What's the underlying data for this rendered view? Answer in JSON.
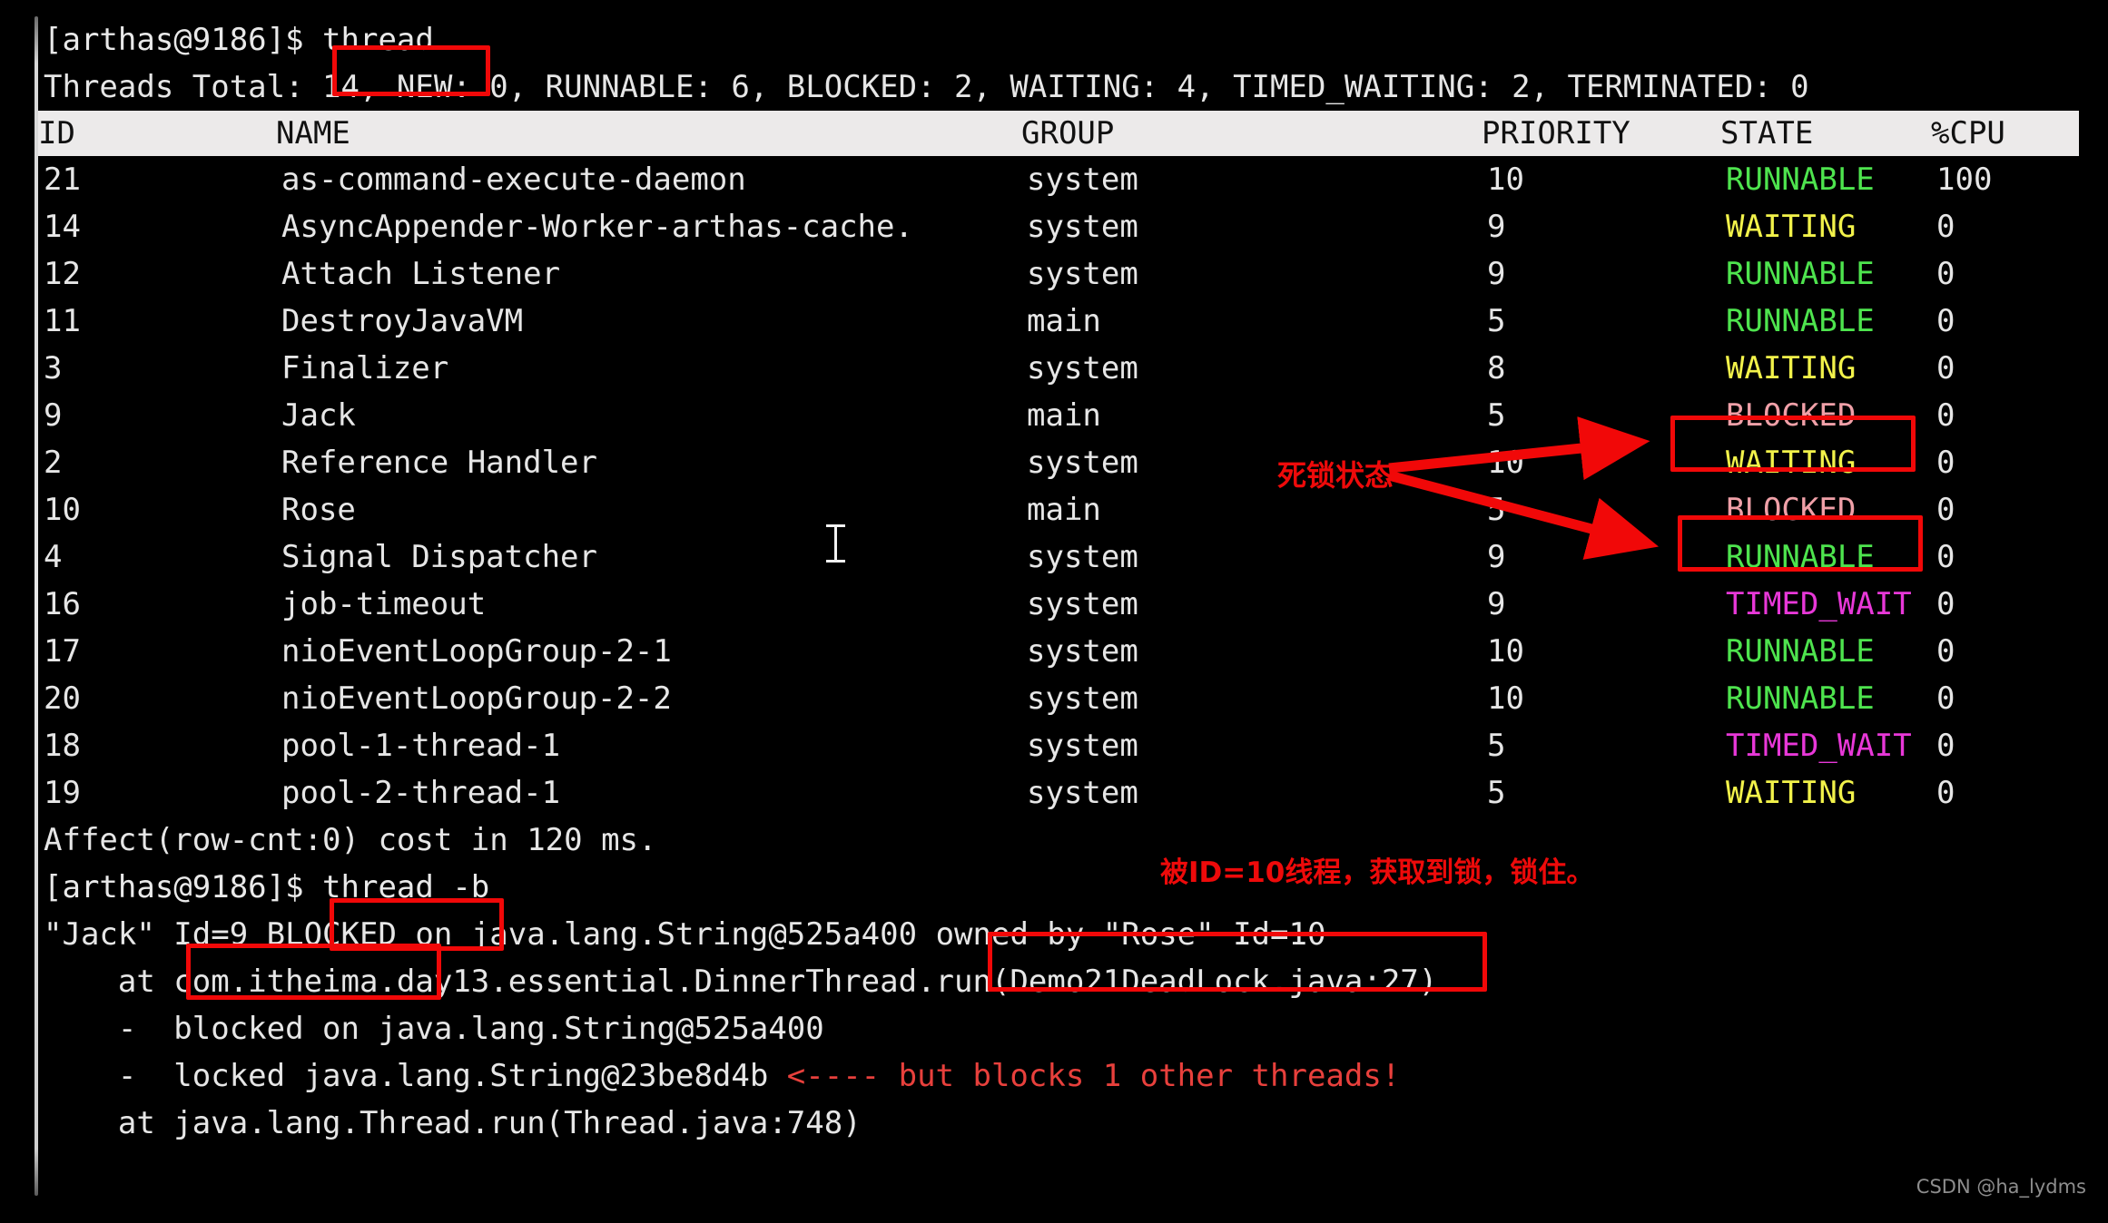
{
  "terminal": {
    "prompt": "[arthas@9186]$ ",
    "command_1": "thread",
    "summary_line": "Threads Total: 14, NEW: 0, RUNNABLE: 6, BLOCKED: 2, WAITING: 4, TIMED_WAITING: 2, TERMINATED: 0",
    "affect_line": "Affect(row-cnt:0) cost in 120 ms.",
    "command_2": "thread -b"
  },
  "table": {
    "headers": {
      "id": "ID",
      "name": "NAME",
      "group": "GROUP",
      "priority": "PRIORITY",
      "state": "STATE",
      "cpu": "%CPU"
    },
    "rows": [
      {
        "id": "21",
        "name": "as-command-execute-daemon",
        "group": "system",
        "priority": "10",
        "state": "RUNNABLE",
        "state_color": "green",
        "cpu": "100"
      },
      {
        "id": "14",
        "name": "AsyncAppender-Worker-arthas-cache.",
        "group": "system",
        "priority": "9",
        "state": "WAITING",
        "state_color": "yellow",
        "cpu": "0"
      },
      {
        "id": "12",
        "name": "Attach Listener",
        "group": "system",
        "priority": "9",
        "state": "RUNNABLE",
        "state_color": "green",
        "cpu": "0"
      },
      {
        "id": "11",
        "name": "DestroyJavaVM",
        "group": "main",
        "priority": "5",
        "state": "RUNNABLE",
        "state_color": "green",
        "cpu": "0"
      },
      {
        "id": "3",
        "name": "Finalizer",
        "group": "system",
        "priority": "8",
        "state": "WAITING",
        "state_color": "yellow",
        "cpu": "0"
      },
      {
        "id": "9",
        "name": "Jack",
        "group": "main",
        "priority": "5",
        "state": "BLOCKED",
        "state_color": "blocked",
        "cpu": "0"
      },
      {
        "id": "2",
        "name": "Reference Handler",
        "group": "system",
        "priority": "10",
        "state": "WAITING",
        "state_color": "yellow",
        "cpu": "0"
      },
      {
        "id": "10",
        "name": "Rose",
        "group": "main",
        "priority": "5",
        "state": "BLOCKED",
        "state_color": "blocked",
        "cpu": "0"
      },
      {
        "id": "4",
        "name": "Signal Dispatcher",
        "group": "system",
        "priority": "9",
        "state": "RUNNABLE",
        "state_color": "green",
        "cpu": "0"
      },
      {
        "id": "16",
        "name": "job-timeout",
        "group": "system",
        "priority": "9",
        "state": "TIMED_WAIT",
        "state_color": "magenta",
        "cpu": "0"
      },
      {
        "id": "17",
        "name": "nioEventLoopGroup-2-1",
        "group": "system",
        "priority": "10",
        "state": "RUNNABLE",
        "state_color": "green",
        "cpu": "0"
      },
      {
        "id": "20",
        "name": "nioEventLoopGroup-2-2",
        "group": "system",
        "priority": "10",
        "state": "RUNNABLE",
        "state_color": "green",
        "cpu": "0"
      },
      {
        "id": "18",
        "name": "pool-1-thread-1",
        "group": "system",
        "priority": "5",
        "state": "TIMED_WAIT",
        "state_color": "magenta",
        "cpu": "0"
      },
      {
        "id": "19",
        "name": "pool-2-thread-1",
        "group": "system",
        "priority": "5",
        "state": "WAITING",
        "state_color": "yellow",
        "cpu": "0"
      }
    ]
  },
  "thread_b_output": {
    "line_1_a": "\"Jack\" ",
    "line_1_b": "Id=9 BLOCKED",
    "line_1_c": " on java.lang.String@525a400 ",
    "line_1_d": "owned by \"Rose\" Id=10",
    "line_2": "    at com.itheima.day13.essential.DinnerThread.run(Demo21DeadLock.java:27)",
    "line_3": "    -  blocked on java.lang.String@525a400",
    "line_4_a": "    -  locked java.lang.String@23be8d4b ",
    "line_4_b": "<---- but blocks 1 other threads!",
    "line_5": "    at java.lang.Thread.run(Thread.java:748)"
  },
  "annotations": {
    "deadlock_label": "死锁状态",
    "locked_by_label": "被ID=10线程，获取到锁，锁住。"
  },
  "watermark": "CSDN @ha_lydms",
  "colors": {
    "accent_red": "#f10808",
    "state_runnable": "#4ee44e",
    "state_waiting": "#f2f24a",
    "state_blocked": "#f0a0a8",
    "state_timed_wait": "#e838d8",
    "terminal_bg": "#000000",
    "header_bg": "#eceaea"
  }
}
